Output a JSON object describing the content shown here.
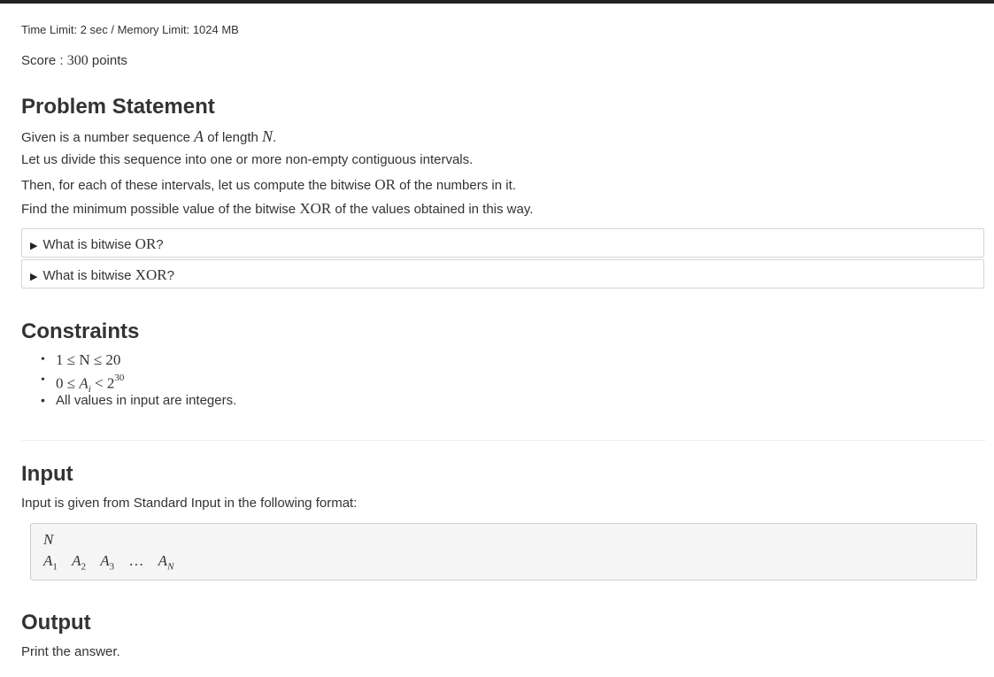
{
  "header": {
    "limits": "Time Limit: 2 sec / Memory Limit: 1024 MB",
    "score_prefix": "Score : ",
    "score_value": "300",
    "score_suffix": " points"
  },
  "problem": {
    "heading": "Problem Statement",
    "line1_a": "Given is a number sequence ",
    "line1_var_a": "A",
    "line1_b": " of length ",
    "line1_var_n": "N",
    "line1_c": ".",
    "line2": "Let us divide this sequence into one or more non-empty contiguous intervals.",
    "line3_a": "Then, for each of these intervals, let us compute the bitwise ",
    "line3_or": "OR",
    "line3_b": " of the numbers in it.",
    "line4_a": "Find the minimum possible value of the bitwise ",
    "line4_xor": "XOR",
    "line4_b": " of the values obtained in this way.",
    "details": [
      {
        "prefix": "What is bitwise ",
        "term": "OR",
        "suffix": "?"
      },
      {
        "prefix": "What is bitwise ",
        "term": "XOR",
        "suffix": "?"
      }
    ]
  },
  "constraints": {
    "heading": "Constraints",
    "c1": "1 ≤ N ≤ 20",
    "c2_base": "0 ≤ ",
    "c2_var": "A",
    "c2_sub": "i",
    "c2_rel": " < 2",
    "c2_exp": "30",
    "c3": "All values in input are integers."
  },
  "input": {
    "heading": "Input",
    "text": "Input is given from Standard Input in the following format:",
    "format_line1": "N",
    "format_terms": [
      {
        "var": "A",
        "sub": "1"
      },
      {
        "var": "A",
        "sub": "2"
      },
      {
        "var": "A",
        "sub": "3"
      },
      {
        "var": "…",
        "sub": ""
      },
      {
        "var": "A",
        "sub": "N"
      }
    ]
  },
  "output": {
    "heading": "Output",
    "text": "Print the answer."
  }
}
